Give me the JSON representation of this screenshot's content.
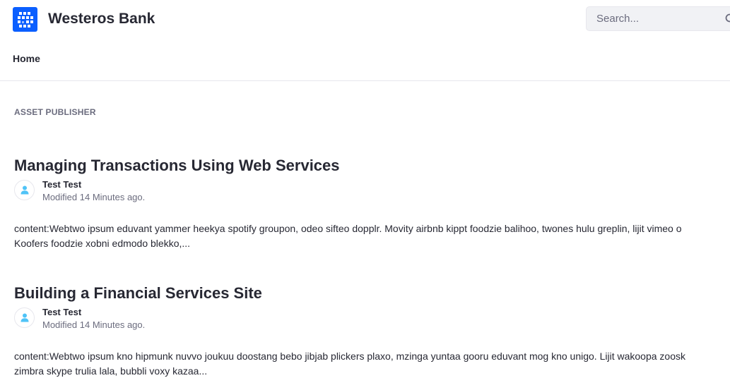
{
  "header": {
    "site_name": "Westeros Bank",
    "logo_icon": "liferay-logo-icon",
    "brand_color": "#0b5fff",
    "search": {
      "placeholder": "Search...",
      "value": "",
      "icon": "search-icon"
    }
  },
  "nav": {
    "items": [
      {
        "label": "Home"
      }
    ]
  },
  "portlet": {
    "title": "ASSET PUBLISHER"
  },
  "entries": [
    {
      "title": "Managing Transactions Using Web Services",
      "author": "Test Test",
      "modified": "Modified 14 Minutes ago.",
      "summary_line1": "content:Webtwo ipsum eduvant yammer heekya spotify groupon, odeo sifteo dopplr. Movity airbnb kippt foodzie balihoo, twones hulu greplin, lijit vimeo o",
      "summary_line2": "Koofers foodzie xobni edmodo blekko,..."
    },
    {
      "title": "Building a Financial Services Site",
      "author": "Test Test",
      "modified": "Modified 14 Minutes ago.",
      "summary_line1": "content:Webtwo ipsum kno hipmunk nuvvo joukuu doostang bebo jibjab plickers plaxo, mzinga yuntaa gooru eduvant mog kno unigo. Lijit wakoopa zoosk",
      "summary_line2": "zimbra skype trulia lala, bubbli voxy kazaa..."
    }
  ]
}
